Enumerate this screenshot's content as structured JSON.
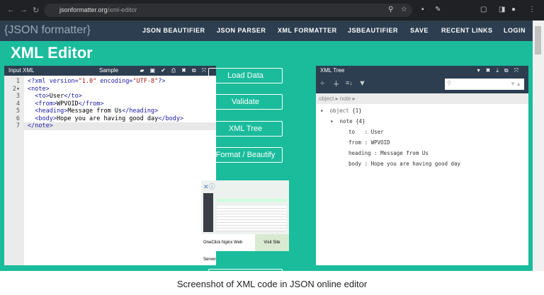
{
  "browser": {
    "url_domain": "jsonformatter.org",
    "url_path": "/xml-editor"
  },
  "site": {
    "logo": "{JSON formatter}",
    "nav": [
      "JSON BEAUTIFIER",
      "JSON PARSER",
      "XML FORMATTER",
      "JSBEAUTIFIER",
      "SAVE",
      "RECENT LINKS",
      "LOGIN"
    ],
    "page_title": "XML Editor",
    "accent": "#1abc9c",
    "nav_bg": "#2c3e50"
  },
  "input_panel": {
    "title": "Input XML",
    "sample_label": "Sample",
    "lines": [
      "<?xml version=\"1.0\" encoding=\"UTF-8\"?>",
      "<note>",
      "  <to>User</to>",
      "  <from>WPVOID</from>",
      "  <heading>Message from Us</heading>",
      "  <body>Hope you are having good day</body>",
      "</note>"
    ]
  },
  "actions": [
    "Load Data",
    "Validate",
    "XML Tree",
    "Format / Beautify"
  ],
  "ad": {
    "label": "OneClick Nginx Web Server",
    "button": "Visit Site"
  },
  "tree_panel": {
    "title": "XML Tree",
    "breadcrumb": "object ▸ note ▸",
    "root": "object",
    "root_count": "{1}",
    "node": "note",
    "node_count": "{4}",
    "items": [
      {
        "key": "to",
        "value": "User"
      },
      {
        "key": "from",
        "value": "WPVOID"
      },
      {
        "key": "heading",
        "value": "Message from Us"
      },
      {
        "key": "body",
        "value": "Hope you are having good day"
      }
    ]
  },
  "caption": "Screenshot of XML code in JSON online editor"
}
